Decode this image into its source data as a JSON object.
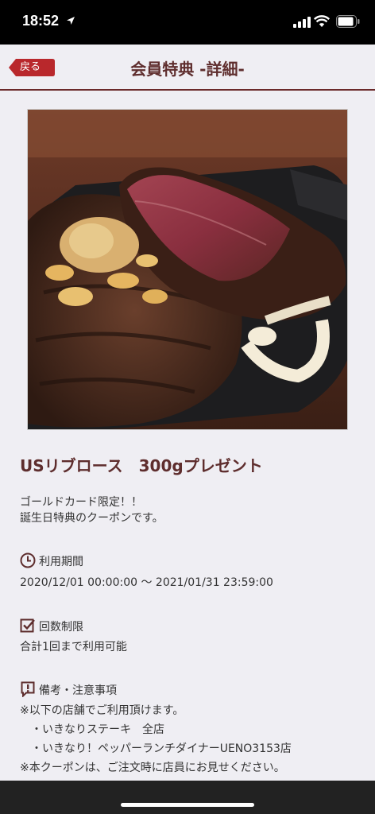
{
  "status_bar": {
    "time": "18:52"
  },
  "nav": {
    "back_label": "戻る",
    "title": "会員特典 -詳細-"
  },
  "coupon": {
    "title": "USリブロース　300gプレゼント",
    "description": [
      "ゴールドカード限定！！",
      "誕生日特典のクーポンです。"
    ]
  },
  "period": {
    "label": "利用期間",
    "value": "2020/12/01 00:00:00 〜 2021/01/31 23:59:00"
  },
  "limit": {
    "label": "回数制限",
    "value": "合計1回まで利用可能"
  },
  "notes": {
    "label": "備考・注意事項",
    "lines": [
      "※以下の店舗でご利用頂けます。",
      "　・いきなりステーキ　全店",
      "　・いきなり！ペッパーランチダイナーUENO3153店",
      "※本クーポンは、ご注文時に店員にお見せください。"
    ]
  },
  "colors": {
    "accent": "#5e2d2d",
    "back_button": "#b9282c",
    "background": "#efeef3"
  },
  "icons": [
    "location-arrow-icon",
    "signal-icon",
    "wifi-icon",
    "battery-icon",
    "clock-icon",
    "checkbox-icon",
    "notice-icon"
  ]
}
